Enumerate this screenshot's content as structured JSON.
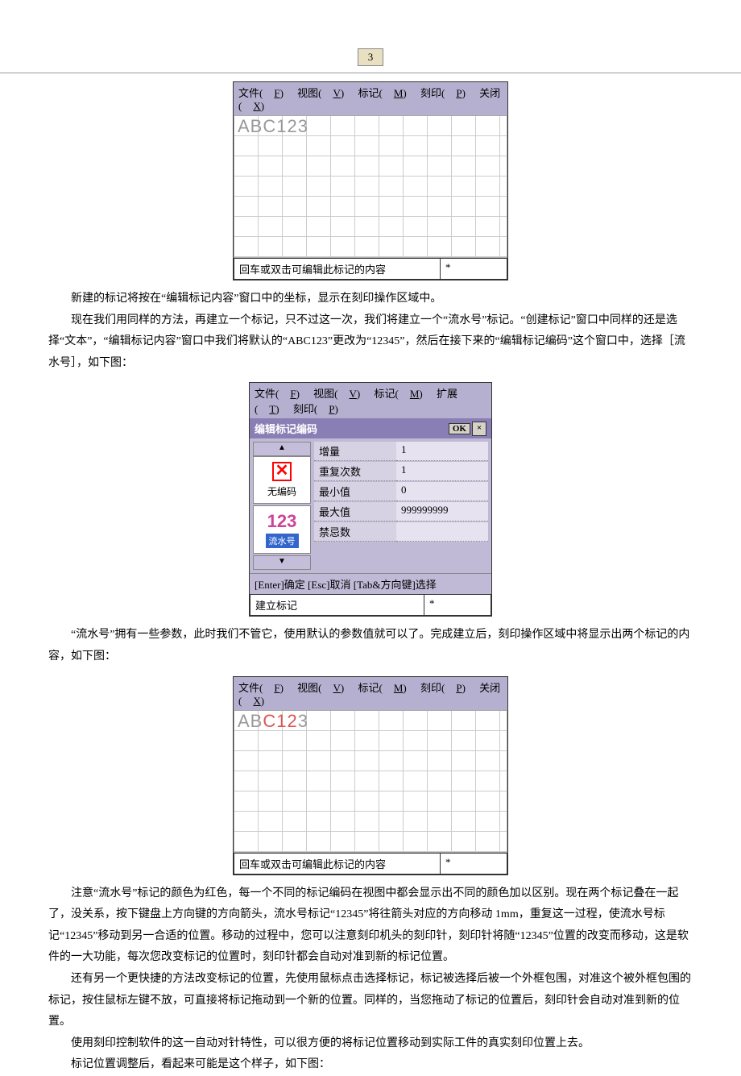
{
  "page_number": "3",
  "screenshot1": {
    "menu": {
      "file": "文件(",
      "file_u": "F",
      "view": "视图(",
      "view_u": "V",
      "mark": "标记(",
      "mark_u": "M",
      "print": "刻印(",
      "print_u": "P",
      "close": "关闭(",
      "close_u": "X"
    },
    "grid_text": "ABC123",
    "status_left": "回车或双击可编辑此标记的内容",
    "status_right": "*"
  },
  "para1": "新建的标记将按在“编辑标记内容”窗口中的坐标，显示在刻印操作区域中。",
  "para2": "现在我们用同样的方法，再建立一个标记，只不过这一次，我们将建立一个“流水号”标记。“创建标记”窗口中同样的还是选择“文本”，“编辑标记内容”窗口中我们将默认的“ABC123”更改为“12345”，然后在接下来的“编辑标记编码”这个窗口中，选择［流水号］，如下图：",
  "screenshot2": {
    "menu": {
      "file": "文件(",
      "file_u": "F",
      "view": "视图(",
      "view_u": "V",
      "mark": "标记(",
      "mark_u": "M",
      "ext": "扩展(",
      "ext_u": "T",
      "print": "刻印(",
      "print_u": "P"
    },
    "title": "编辑标记编码",
    "ok": "OK",
    "side": {
      "noencode": "无编码",
      "num123": "123",
      "serial": "流水号"
    },
    "params": [
      {
        "label": "增量",
        "value": "1"
      },
      {
        "label": "重复次数",
        "value": "1"
      },
      {
        "label": "最小值",
        "value": "0"
      },
      {
        "label": "最大值",
        "value": "999999999"
      },
      {
        "label": "禁忌数",
        "value": ""
      }
    ],
    "hint": "[Enter]确定  [Esc]取消  [Tab&方向键]选择",
    "status_left": "建立标记",
    "status_right": "*"
  },
  "para3": "“流水号”拥有一些参数，此时我们不管它，使用默认的参数值就可以了。完成建立后，刻印操作区域中将显示出两个标记的内容，如下图：",
  "screenshot3": {
    "menu": {
      "file": "文件(",
      "file_u": "F",
      "view": "视图(",
      "view_u": "V",
      "mark": "标记(",
      "mark_u": "M",
      "print": "刻印(",
      "print_u": "P",
      "close": "关闭(",
      "close_u": "X"
    },
    "grid_text1": "ABC123",
    "grid_text2": "",
    "status_left": "回车或双击可编辑此标记的内容",
    "status_right": "*"
  },
  "para4": "注意“流水号”标记的颜色为红色，每一个不同的标记编码在视图中都会显示出不同的颜色加以区别。现在两个标记叠在一起了，没关系，按下键盘上方向键的方向箭头，流水号标记“12345”将往箭头对应的方向移动 1mm，重复这一过程，使流水号标记“12345”移动到另一合适的位置。移动的过程中，您可以注意刻印机头的刻印针，刻印针将随“12345”位置的改变而移动，这是软件的一大功能，每次您改变标记的位置时，刻印针都会自动对准到新的标记位置。",
  "para5": "还有另一个更快捷的方法改变标记的位置，先使用鼠标点击选择标记，标记被选择后被一个外框包围，对准这个被外框包围的标记，按住鼠标左键不放，可直接将标记拖动到一个新的位置。同样的，当您拖动了标记的位置后，刻印针会自动对准到新的位置。",
  "para6": "使用刻印控制软件的这一自动对针特性，可以很方便的将标记位置移动到实际工件的真实刻印位置上去。",
  "para7": "标记位置调整后，看起来可能是这个样子，如下图："
}
